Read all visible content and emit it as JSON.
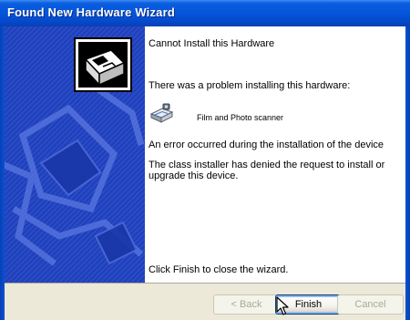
{
  "window": {
    "title": "Found New Hardware Wizard"
  },
  "content": {
    "heading": "Cannot Install this Hardware",
    "problem_text": "There was a problem installing this hardware:",
    "device_name": "Film and Photo scanner",
    "error_text": "An error occurred during the installation of the device",
    "detail_line1": "The class installer has denied the request to install or",
    "detail_line2": "upgrade this device.",
    "close_text": "Click Finish to close the wizard."
  },
  "buttons": {
    "back_label": "< Back",
    "finish_label": "Finish",
    "cancel_label": "Cancel"
  },
  "colors": {
    "titlebar": "#0553d8",
    "banner": "#1f3fb8",
    "dialog_background": "#ece9d8"
  }
}
